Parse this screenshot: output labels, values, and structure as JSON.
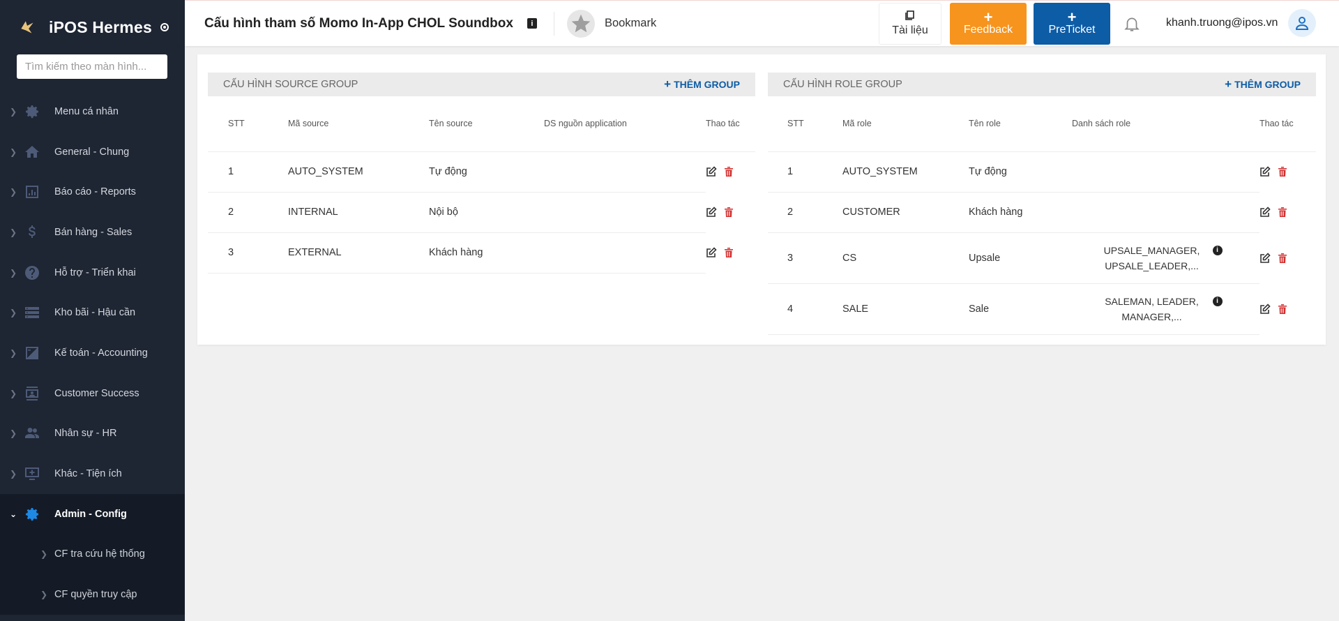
{
  "sidebar": {
    "brand": "iPOS Hermes",
    "search_placeholder": "Tìm kiếm theo màn hình...",
    "items": [
      {
        "label": "Menu cá nhân",
        "icon": "gear-icon"
      },
      {
        "label": "General - Chung",
        "icon": "home-icon"
      },
      {
        "label": "Báo cáo - Reports",
        "icon": "bar-chart-icon"
      },
      {
        "label": "Bán hàng - Sales",
        "icon": "dollar-icon"
      },
      {
        "label": "Hỗ trợ - Triển khai",
        "icon": "help-circle-icon"
      },
      {
        "label": "Kho bãi - Hậu cần",
        "icon": "storage-icon"
      },
      {
        "label": "Kế toán - Accounting",
        "icon": "calculator-icon"
      },
      {
        "label": "Customer Success",
        "icon": "contact-card-icon"
      },
      {
        "label": "Nhân sự - HR",
        "icon": "people-icon"
      },
      {
        "label": "Khác - Tiện ích",
        "icon": "add-screen-icon"
      },
      {
        "label": "Admin - Config",
        "icon": "gear-icon",
        "active": true
      }
    ],
    "subitems": [
      {
        "label": "CF tra cứu hệ thống"
      },
      {
        "label": "CF quyền truy cập"
      }
    ]
  },
  "header": {
    "title": "Cấu hình tham số Momo In-App CHOL Soundbox",
    "info": "i",
    "bookmark": "Bookmark",
    "docs": "Tài liệu",
    "feedback": "Feedback",
    "preticket": "PreTicket",
    "plus": "+",
    "user_email": "khanh.truong@ipos.vn"
  },
  "source_group": {
    "title": "CẤU HÌNH SOURCE GROUP",
    "add_label": "THÊM GROUP",
    "columns": [
      "STT",
      "Mã source",
      "Tên source",
      "DS nguồn application",
      "Thao tác"
    ],
    "rows": [
      {
        "stt": "1",
        "code": "AUTO_SYSTEM",
        "name": "Tự động",
        "apps": ""
      },
      {
        "stt": "2",
        "code": "INTERNAL",
        "name": "Nội bộ",
        "apps": ""
      },
      {
        "stt": "3",
        "code": "EXTERNAL",
        "name": "Khách hàng",
        "apps": ""
      }
    ]
  },
  "role_group": {
    "title": "CẤU HÌNH ROLE GROUP",
    "add_label": "THÊM GROUP",
    "columns": [
      "STT",
      "Mã role",
      "Tên role",
      "Danh sách role",
      "Thao tác"
    ],
    "rows": [
      {
        "stt": "1",
        "code": "AUTO_SYSTEM",
        "name": "Tự động",
        "roles_l1": "",
        "roles_l2": ""
      },
      {
        "stt": "2",
        "code": "CUSTOMER",
        "name": "Khách hàng",
        "roles_l1": "",
        "roles_l2": ""
      },
      {
        "stt": "3",
        "code": "CS",
        "name": "Upsale",
        "roles_l1": "UPSALE_MANAGER,",
        "roles_l2": "UPSALE_LEADER,..."
      },
      {
        "stt": "4",
        "code": "SALE",
        "name": "Sale",
        "roles_l1": "SALEMAN, LEADER,",
        "roles_l2": "MANAGER,..."
      }
    ]
  },
  "colors": {
    "sidebar_bg": "#1e2533",
    "accent_blue": "#0d5ca6",
    "feedback_orange": "#f7941d",
    "delete_red": "#d32f2f"
  }
}
